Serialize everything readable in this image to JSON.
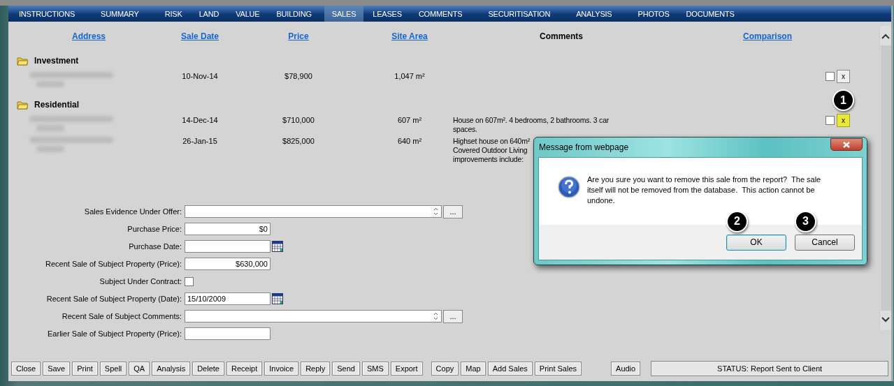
{
  "tabs": [
    {
      "label": "INSTRUCTIONS",
      "selected": false
    },
    {
      "label": "SUMMARY",
      "selected": false
    },
    {
      "label": "RISK",
      "selected": false
    },
    {
      "label": "LAND",
      "selected": false
    },
    {
      "label": "VALUE",
      "selected": false
    },
    {
      "label": "BUILDING",
      "selected": false
    },
    {
      "label": "SALES",
      "selected": true
    },
    {
      "label": "LEASES",
      "selected": false
    },
    {
      "label": "COMMENTS",
      "selected": false
    },
    {
      "label": "SECURITISATION",
      "selected": false
    },
    {
      "label": "ANALYSIS",
      "selected": false
    },
    {
      "label": "PHOTOS",
      "selected": false
    },
    {
      "label": "DOCUMENTS",
      "selected": false
    }
  ],
  "table": {
    "columns": [
      {
        "label": "Address",
        "kind": "link"
      },
      {
        "label": "Sale Date",
        "kind": "link"
      },
      {
        "label": "Price",
        "kind": "link"
      },
      {
        "label": "Site Area",
        "kind": "link"
      },
      {
        "label": "Comments",
        "kind": "plain"
      },
      {
        "label": "Comparison",
        "kind": "link"
      }
    ],
    "groups": [
      {
        "name": "Investment",
        "rows": [
          {
            "sale_date": "10-Nov-14",
            "price": "$78,900",
            "site_area": "1,047 m²",
            "comment_lines": [],
            "checked": false,
            "remove": "x",
            "highlighted": false
          }
        ]
      },
      {
        "name": "Residential",
        "rows": [
          {
            "sale_date": "14-Dec-14",
            "price": "$710,000",
            "site_area": "607 m²",
            "comment_lines": [
              "House on 607m². 4 bedrooms, 2 bathrooms. 3 car",
              "spaces."
            ],
            "checked": false,
            "remove": "x",
            "highlighted": true,
            "callout": "1"
          },
          {
            "sale_date": "26-Jan-15",
            "price": "$825,000",
            "site_area": "640 m²",
            "comment_lines": [
              "Highset house on 640m²",
              "Covered Outdoor Living",
              "improvements include:"
            ]
          }
        ]
      }
    ]
  },
  "form": {
    "fields": [
      {
        "label": "Sales Evidence Under Offer:",
        "kind": "memo",
        "more": "..."
      },
      {
        "label": "Purchase Price:",
        "kind": "money",
        "value": "$0"
      },
      {
        "label": "Purchase Date:",
        "kind": "date"
      },
      {
        "label": "Recent Sale of Subject Property (Price):",
        "kind": "money",
        "value": "$630,000"
      },
      {
        "label": "Subject Under Contract:",
        "kind": "checkbox",
        "checked": false
      },
      {
        "label": "Recent Sale of Subject Property (Date):",
        "kind": "date",
        "value": "15/10/2009"
      },
      {
        "label": "Recent Sale of Subject Comments:",
        "kind": "memo",
        "more": "..."
      },
      {
        "label": "Earlier Sale of Subject Property (Price):",
        "kind": "money"
      }
    ]
  },
  "dialog": {
    "title": "Message from webpage",
    "message": "Are you sure you want to remove this sale from the report?  The sale itself will not be removed from the database.  This action cannot be undone.",
    "buttons": [
      {
        "label": "OK",
        "default": true,
        "callout": "2"
      },
      {
        "label": "Cancel",
        "default": false,
        "callout": "3"
      }
    ]
  },
  "toolbar": {
    "groups": [
      [
        "Close",
        "Save",
        "Print",
        "Spell",
        "QA",
        "Analysis",
        "Delete",
        "Receipt",
        "Invoice",
        "Reply",
        "Send",
        "SMS",
        "Export"
      ],
      [
        "Copy",
        "Map",
        "Add Sales",
        "Print Sales"
      ],
      [
        "Audio"
      ]
    ],
    "status": "STATUS: Report Sent to Client"
  }
}
